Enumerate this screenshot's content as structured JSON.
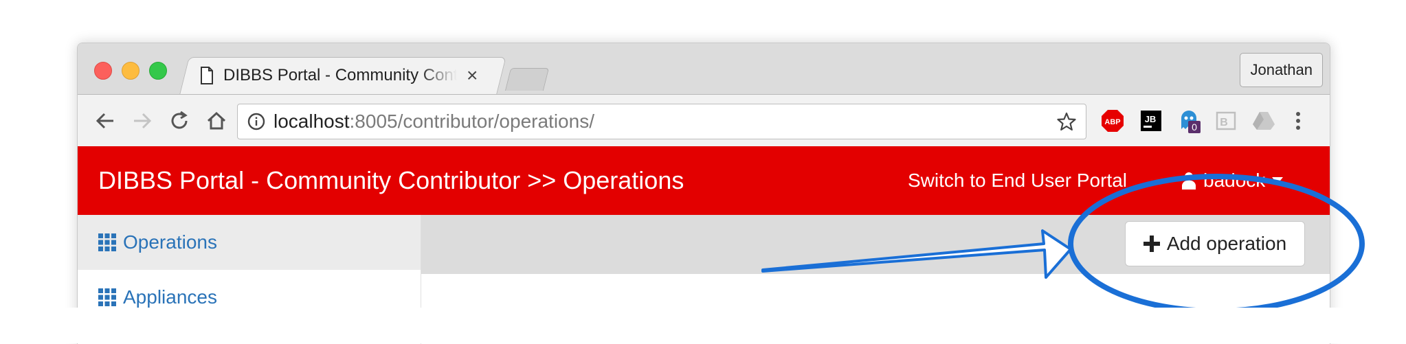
{
  "browser": {
    "tab_title": "DIBBS Portal - Community Contributor >> Operations",
    "tab_close": "×",
    "profile_name": "Jonathan",
    "url_host": "localhost",
    "url_rest": ":8005/contributor/operations/",
    "extensions": [
      {
        "name": "adblock-plus-icon",
        "label": "ABP",
        "color": "#e60000"
      },
      {
        "name": "jetbrains-icon",
        "label": "JB",
        "color": "#000000"
      },
      {
        "name": "ghostery-icon",
        "badge": "0",
        "color": "#2d8fd5"
      },
      {
        "name": "bookmark-ext-icon",
        "label": "B",
        "color": "#bfbfbf"
      },
      {
        "name": "google-drive-icon",
        "color": "#bfbfbf"
      }
    ]
  },
  "navbar": {
    "brand": "DIBBS Portal - Community Contributor >> Operations",
    "switch_link": "Switch to End User Portal",
    "user": "badock",
    "color": "#e30000"
  },
  "sidebar": {
    "items": [
      {
        "label": "Operations",
        "active": true
      },
      {
        "label": "Appliances",
        "active": false
      }
    ]
  },
  "main": {
    "add_button_label": "Add operation"
  },
  "annotation_color": "#1a6fd6"
}
